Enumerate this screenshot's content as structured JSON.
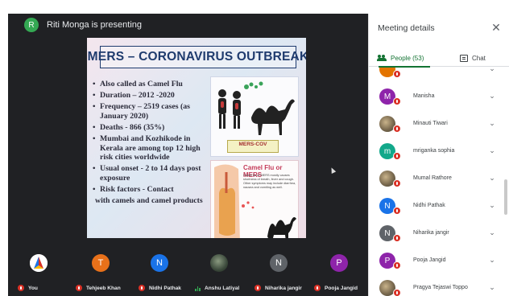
{
  "presenter": {
    "initial": "R",
    "text": "Riti Monga is presenting",
    "color": "#34a853"
  },
  "slide": {
    "title": "MERS – CORONAVIRUS OUTBREAK",
    "bullets": [
      "Also called as Camel Flu",
      "Duration – 2012 -2020",
      "Frequency – 2519 cases (as January 2020)",
      "Deaths - 866 (35%)",
      "Mumbai and Kozhikode in Kerala are among top 12 high risk cities worldwide",
      "Usual onset - 2 to 14 days post exposure",
      "Risk factors - Contact",
      "with camels and camel products"
    ],
    "image1_caption": "MERS-COV",
    "image2_title": "Camel Flu or MERS",
    "image2_text": "Camel flu or MERS mostly causes shortness of breath, fever and cough. Other symptoms may include diarrhea, nausea and vomiting as well."
  },
  "tiles": [
    {
      "name": "You",
      "initial": "",
      "color": "#ffffff",
      "mic": "off"
    },
    {
      "name": "Tehjeeb Khan",
      "initial": "T",
      "color": "#e8711a",
      "mic": "off"
    },
    {
      "name": "Nidhi Pathak",
      "initial": "N",
      "color": "#1a73e8",
      "mic": "off"
    },
    {
      "name": "Anshu Latiyal",
      "initial": "",
      "color": "#3c4a3c",
      "mic": "on"
    },
    {
      "name": "Niharika jangir",
      "initial": "N",
      "color": "#5f6368",
      "mic": "off"
    },
    {
      "name": "Pooja Jangid",
      "initial": "P",
      "color": "#8e24aa",
      "mic": "off"
    }
  ],
  "panel": {
    "title": "Meeting details",
    "close_icon": "close-icon",
    "tab_people": "People (53)",
    "tab_chat": "Chat",
    "participants": [
      {
        "name": "",
        "initial": "",
        "color": "#e37400"
      },
      {
        "name": "Manisha",
        "initial": "M",
        "color": "#8e24aa"
      },
      {
        "name": "Minauti Tiwari",
        "initial": "",
        "color": "photo"
      },
      {
        "name": "mriganka sophia",
        "initial": "m",
        "color": "#12a88a"
      },
      {
        "name": "Mumal Rathore",
        "initial": "",
        "color": "photo"
      },
      {
        "name": "Nidhi Pathak",
        "initial": "N",
        "color": "#1a73e8"
      },
      {
        "name": "Niharika jangir",
        "initial": "N",
        "color": "#5f6368"
      },
      {
        "name": "Pooja Jangid",
        "initial": "P",
        "color": "#8e24aa"
      },
      {
        "name": "Pragya Tejaswi Toppo",
        "initial": "",
        "color": "photo"
      }
    ]
  }
}
